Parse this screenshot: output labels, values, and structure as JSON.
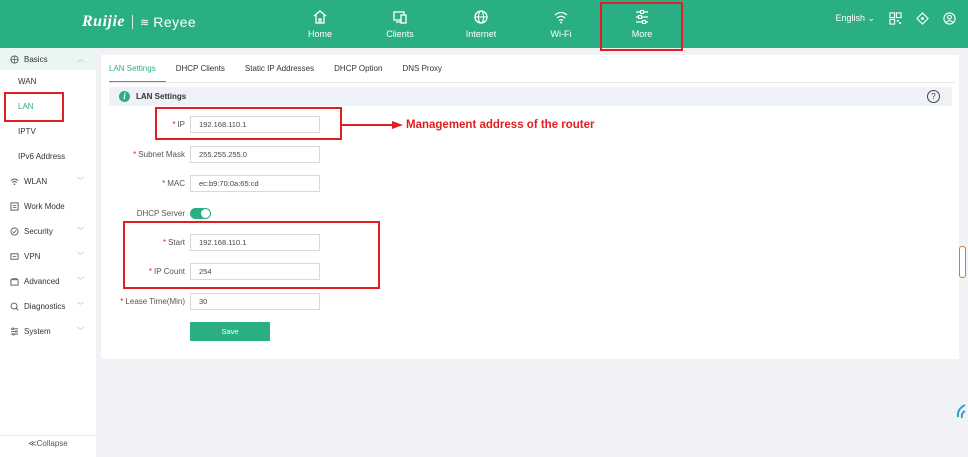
{
  "header": {
    "logo_ruijie": "Ruijie",
    "logo_reyee_mark": "≋",
    "logo_reyee": "Reyee",
    "nav": [
      {
        "label": "Home",
        "icon": "home-icon"
      },
      {
        "label": "Clients",
        "icon": "clients-icon"
      },
      {
        "label": "Internet",
        "icon": "globe-icon"
      },
      {
        "label": "Wi-Fi",
        "icon": "wifi-icon"
      },
      {
        "label": "More",
        "icon": "more-icon"
      }
    ],
    "language": "English ⌄"
  },
  "sidebar": {
    "items": [
      {
        "label": "Basics",
        "icon": "basics-icon"
      },
      {
        "label": "WAN"
      },
      {
        "label": "LAN"
      },
      {
        "label": "IPTV"
      },
      {
        "label": "IPv6 Address"
      },
      {
        "label": "WLAN",
        "icon": "wlan-icon"
      },
      {
        "label": "Work Mode",
        "icon": "work-mode-icon"
      },
      {
        "label": "Security",
        "icon": "security-icon"
      },
      {
        "label": "VPN",
        "icon": "vpn-icon"
      },
      {
        "label": "Advanced",
        "icon": "advanced-icon"
      },
      {
        "label": "Diagnostics",
        "icon": "diagnostics-icon"
      },
      {
        "label": "System",
        "icon": "system-icon"
      }
    ],
    "collapse": "≪Collapse"
  },
  "tabs": [
    "LAN Settings",
    "DHCP Clients",
    "Static IP Addresses",
    "DHCP Option",
    "DNS Proxy"
  ],
  "section": {
    "title": "LAN Settings"
  },
  "form": {
    "ip_label": "IP",
    "ip_value": "192.168.110.1",
    "subnet_label": "Subnet Mask",
    "subnet_value": "255.255.255.0",
    "mac_label": "MAC",
    "mac_value": "ec:b9:70:0a:65:cd",
    "dhcp_label": "DHCP Server",
    "dhcp_enabled": true,
    "start_label": "Start",
    "start_value": "192.168.110.1",
    "count_label": "IP Count",
    "count_value": "254",
    "lease_label": "Lease Time(Min)",
    "lease_value": "30",
    "save_label": "Save",
    "required_mark": "*"
  },
  "annotation": {
    "text": "Management address of the router",
    "color": "#e02020"
  },
  "colors": {
    "accent": "#2aae84",
    "highlight": "#e02020"
  }
}
